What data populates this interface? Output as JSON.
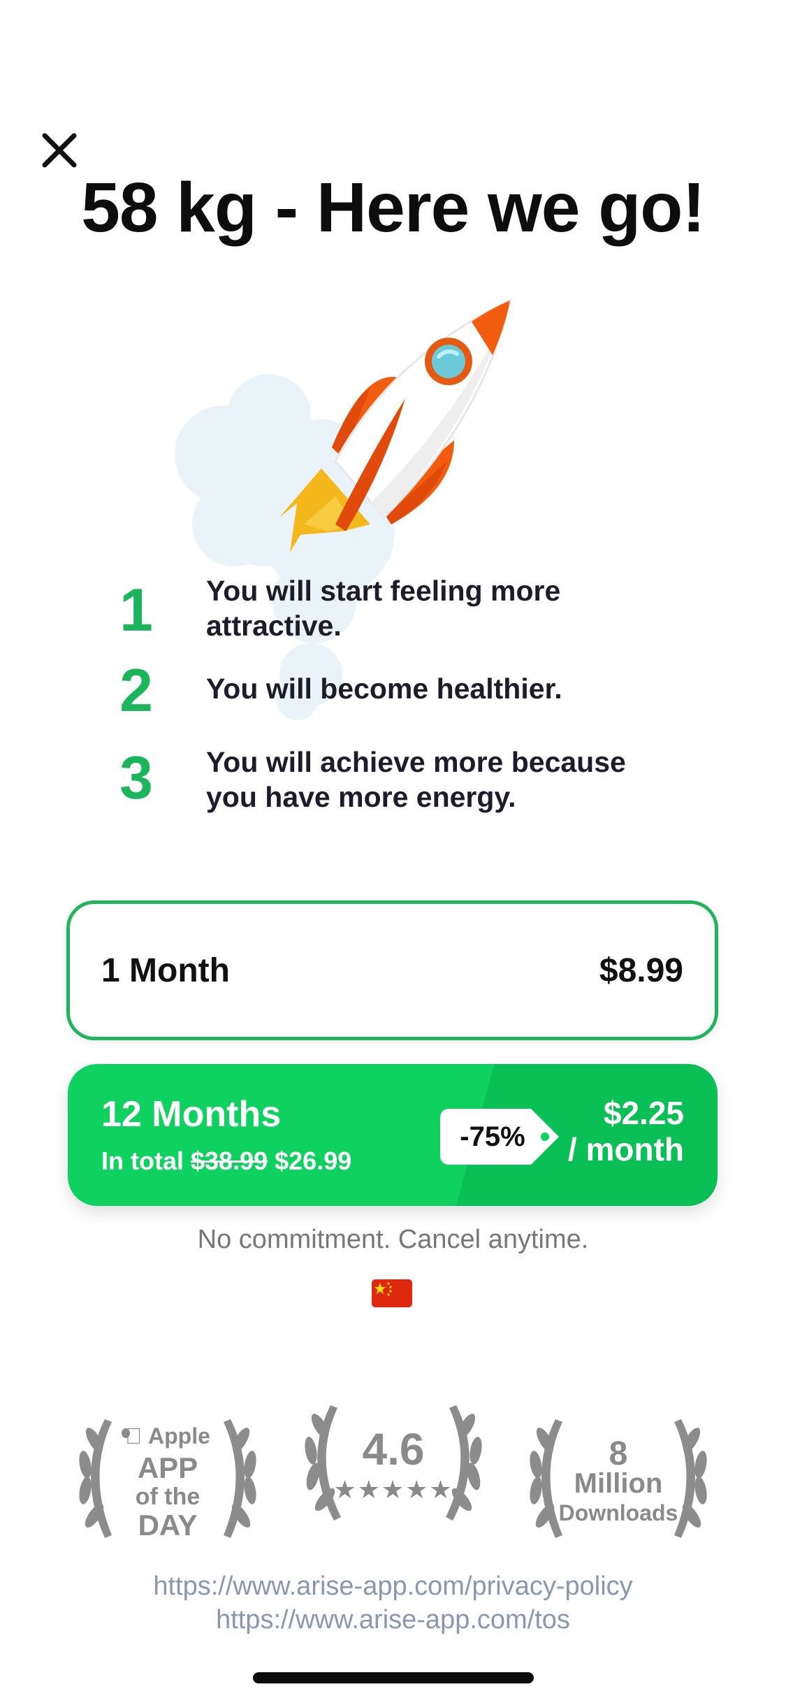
{
  "title": "58 kg - Here we go!",
  "close_icon": "close-icon",
  "benefits": [
    {
      "num": "1",
      "text": "You will start feeling more attractive."
    },
    {
      "num": "2",
      "text": "You will become healthier."
    },
    {
      "num": "3",
      "text": "You will achieve more because you have more energy."
    }
  ],
  "plans": {
    "monthly": {
      "label": "1 Month",
      "price": "$8.99"
    },
    "yearly": {
      "label": "12 Months",
      "total_prefix": "In total",
      "old_price": "$38.99",
      "new_price": "$26.99",
      "discount": "-75%",
      "price_per": "$2.25",
      "per_unit": "/ month"
    }
  },
  "no_commitment": "No commitment. Cancel anytime.",
  "flag_icon": "china-flag-icon",
  "badges": {
    "app_of_day": {
      "brand": "Apple",
      "line1": "APP",
      "line2": "of the",
      "line3": "DAY"
    },
    "rating": {
      "value": "4.6",
      "stars": "★★★★★"
    },
    "downloads": {
      "line1": "8",
      "line2": "Million",
      "line3": "Downloads"
    }
  },
  "links": {
    "privacy": "https://www.arise-app.com/privacy-policy",
    "tos": "https://www.arise-app.com/tos"
  },
  "colors": {
    "accent_green": "#1bb55c",
    "card_green": "#0fd160",
    "link_gray": "#8a97ad"
  }
}
